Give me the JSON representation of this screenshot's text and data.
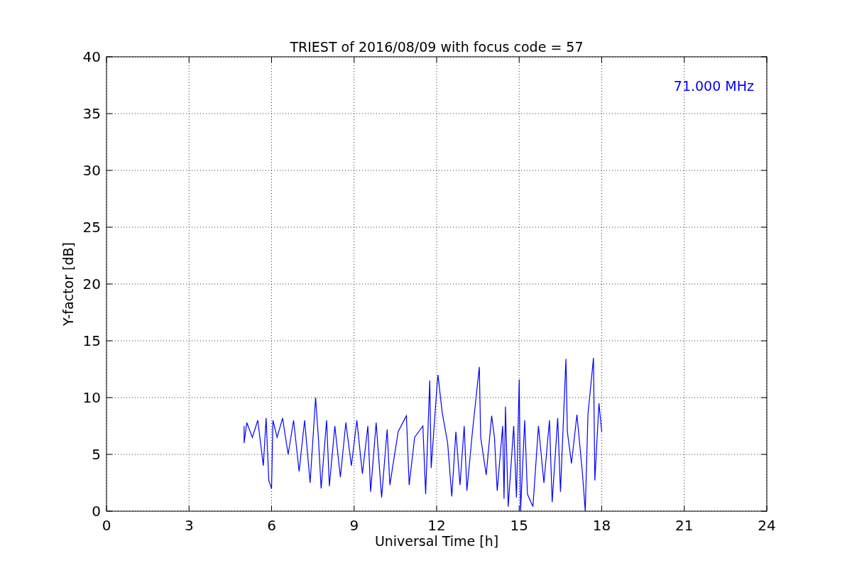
{
  "figure": {
    "chart_data": {
      "type": "line",
      "title": "TRIEST of 2016/08/09 with focus code = 57",
      "xlabel": "Universal Time [h]",
      "ylabel": "Y-factor [dB]",
      "x": [
        5.0,
        5.0,
        5.1,
        5.3,
        5.5,
        5.7,
        5.8,
        5.9,
        6.0,
        6.05,
        6.2,
        6.4,
        6.6,
        6.8,
        7.0,
        7.2,
        7.4,
        7.6,
        7.7,
        7.8,
        8.0,
        8.1,
        8.3,
        8.5,
        8.7,
        8.9,
        9.1,
        9.3,
        9.5,
        9.6,
        9.8,
        10.0,
        10.2,
        10.3,
        10.6,
        10.9,
        11.0,
        11.2,
        11.5,
        11.6,
        11.75,
        11.8,
        12.0,
        12.05,
        12.2,
        12.4,
        12.55,
        12.7,
        12.85,
        13.0,
        13.1,
        13.3,
        13.55,
        13.6,
        13.8,
        14.0,
        14.1,
        14.2,
        14.4,
        14.45,
        14.5,
        14.6,
        14.8,
        14.9,
        15.0,
        15.05,
        15.2,
        15.3,
        15.5,
        15.7,
        15.9,
        16.1,
        16.2,
        16.4,
        16.5,
        16.7,
        16.75,
        16.9,
        17.1,
        17.3,
        17.4,
        17.5,
        17.7,
        17.75,
        17.9,
        18.0
      ],
      "series": [
        {
          "color": "#0000ff",
          "values": [
            7.5,
            6.0,
            7.8,
            6.5,
            8.0,
            4.0,
            8.2,
            2.7,
            2.0,
            8.0,
            6.5,
            8.2,
            5.0,
            8.0,
            3.5,
            8.0,
            2.5,
            10.0,
            6.5,
            2.0,
            8.0,
            2.2,
            7.5,
            3.0,
            7.8,
            4.0,
            8.0,
            3.3,
            7.5,
            1.7,
            7.8,
            1.2,
            7.2,
            2.3,
            7.0,
            8.4,
            2.3,
            6.5,
            7.5,
            1.5,
            11.5,
            3.8,
            10.6,
            12.0,
            8.7,
            6.0,
            1.3,
            7.0,
            2.3,
            7.5,
            1.8,
            7.0,
            12.7,
            6.5,
            3.2,
            8.4,
            6.5,
            1.8,
            7.5,
            1.1,
            9.2,
            0.4,
            7.5,
            1.2,
            11.6,
            0.0,
            8.0,
            1.5,
            0.4,
            7.5,
            2.5,
            8.0,
            0.8,
            8.2,
            1.7,
            13.4,
            7.0,
            4.2,
            8.5,
            3.3,
            0.0,
            8.5,
            13.5,
            2.7,
            9.5,
            7.0
          ]
        }
      ],
      "xlim": [
        0,
        24
      ],
      "ylim": [
        0,
        40
      ],
      "xticks": [
        0,
        3,
        6,
        9,
        12,
        15,
        18,
        21,
        24
      ],
      "yticks": [
        0,
        5,
        10,
        15,
        20,
        25,
        30,
        35,
        40
      ],
      "grid": true,
      "annotations": [
        {
          "text": "71.000 MHz"
        }
      ]
    }
  }
}
